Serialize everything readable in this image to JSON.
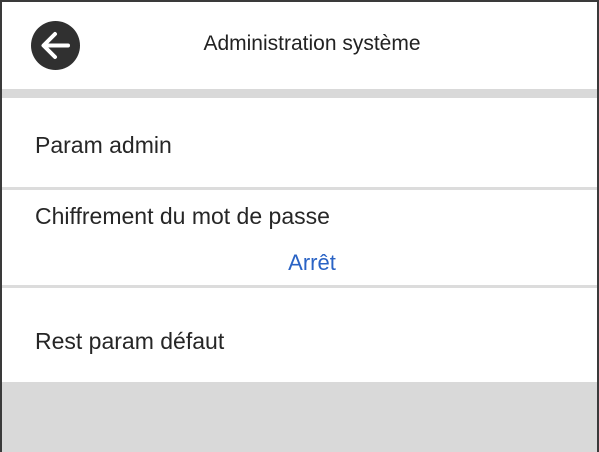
{
  "header": {
    "title": "Administration système",
    "back_icon": "back-arrow-icon"
  },
  "menu": {
    "items": [
      {
        "label": "Param admin"
      },
      {
        "label": "Chiffrement du mot de passe",
        "value": "Arrêt"
      },
      {
        "label": "Rest param défaut"
      }
    ]
  },
  "colors": {
    "value_text": "#2a63c5",
    "divider": "#dcdcdc",
    "back_button": "#303030"
  }
}
